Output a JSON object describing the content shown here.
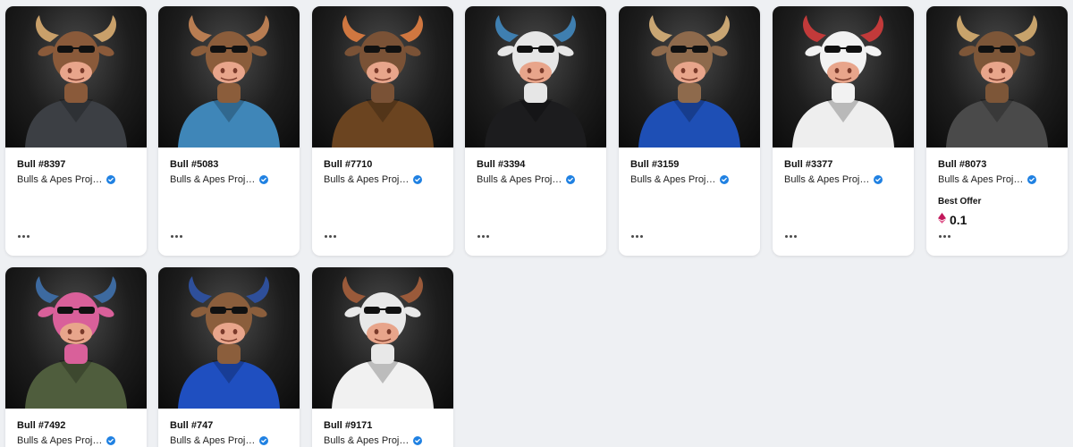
{
  "cards": [
    {
      "title": "Bull #8397",
      "collection": "Bulls & Apes Proje…",
      "horn_color": "#c9a06a",
      "outfit_color": "#3c3f44",
      "head_color": "#8a5a3a"
    },
    {
      "title": "Bull #5083",
      "collection": "Bulls & Apes Proje…",
      "horn_color": "#b87d52",
      "outfit_color": "#3f86b8",
      "head_color": "#8b5d3b"
    },
    {
      "title": "Bull #7710",
      "collection": "Bulls & Apes Proje…",
      "horn_color": "#d07740",
      "outfit_color": "#6b4420",
      "head_color": "#7a5236"
    },
    {
      "title": "Bull #3394",
      "collection": "Bulls & Apes Proje…",
      "horn_color": "#3f7fb0",
      "outfit_color": "#1c1c1e",
      "head_color": "#e6e6e6"
    },
    {
      "title": "Bull #3159",
      "collection": "Bulls & Apes Proje…",
      "horn_color": "#c9a673",
      "outfit_color": "#1e4fb5",
      "head_color": "#8e6a4c"
    },
    {
      "title": "Bull #3377",
      "collection": "Bulls & Apes Proje…",
      "horn_color": "#c23a3a",
      "outfit_color": "#eeeeee",
      "head_color": "#f2f2f2"
    },
    {
      "title": "Bull #8073",
      "collection": "Bulls & Apes Proje…",
      "horn_color": "#c8a36b",
      "outfit_color": "#4a4a4a",
      "head_color": "#7d5638",
      "best_offer_label": "Best Offer",
      "best_offer_value": "0.1"
    },
    {
      "title": "Bull #7492",
      "collection": "Bulls & Apes Proje…",
      "horn_color": "#3d6aa0",
      "outfit_color": "#4f5d3d",
      "head_color": "#d9609a"
    },
    {
      "title": "Bull #747",
      "collection": "Bulls & Apes Proje…",
      "horn_color": "#2e4f9a",
      "outfit_color": "#1f4fc0",
      "head_color": "#8b5e3c"
    },
    {
      "title": "Bull #9171",
      "collection": "Bulls & Apes Proje…",
      "horn_color": "#9a5a3a",
      "outfit_color": "#f1f1f1",
      "head_color": "#e8e8e8"
    }
  ],
  "colors": {
    "verified_blue": "#2081e2",
    "eth_pink": "#c2185b",
    "card_bg": "#ffffff",
    "page_bg": "#eef0f3"
  }
}
